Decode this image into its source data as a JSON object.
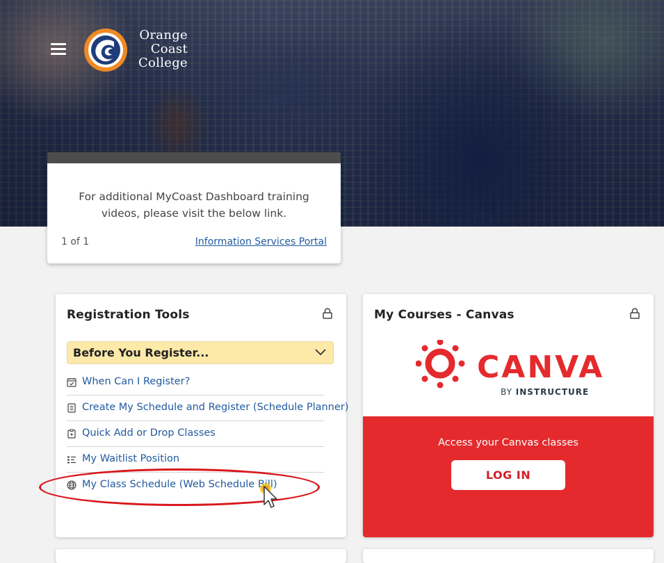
{
  "header": {
    "logo_lines": [
      "Orange",
      "Coast",
      "College"
    ]
  },
  "announcement": {
    "message": "For additional MyCoast Dashboard training videos, please visit the below link.",
    "pager": "1 of 1",
    "link_label": "Information Services Portal"
  },
  "registration": {
    "title": "Registration Tools",
    "accordion_label": "Before You Register...",
    "links": [
      {
        "label": "When Can I Register?",
        "icon": "calendar-check-icon"
      },
      {
        "label": "Create My Schedule and Register (Schedule Planner)",
        "icon": "document-list-icon"
      },
      {
        "label": "Quick Add or Drop Classes",
        "icon": "clipboard-icon"
      },
      {
        "label": "My Waitlist Position",
        "icon": "list-icon"
      },
      {
        "label": "My Class Schedule (Web Schedule Bill)",
        "icon": "globe-icon"
      }
    ]
  },
  "canvas": {
    "title": "My Courses - Canvas",
    "brand": "CANVAS",
    "brand_sub_prefix": "BY",
    "brand_sub": "INSTRUCTURE",
    "access_text": "Access your Canvas classes",
    "login_label": "LOG IN"
  },
  "colors": {
    "accent_link": "#1f5a9e",
    "canvas_red": "#e42a2d",
    "accordion_bg": "#fde9a8",
    "highlight_red": "#d8181d",
    "occ_orange": "#f08a24"
  }
}
